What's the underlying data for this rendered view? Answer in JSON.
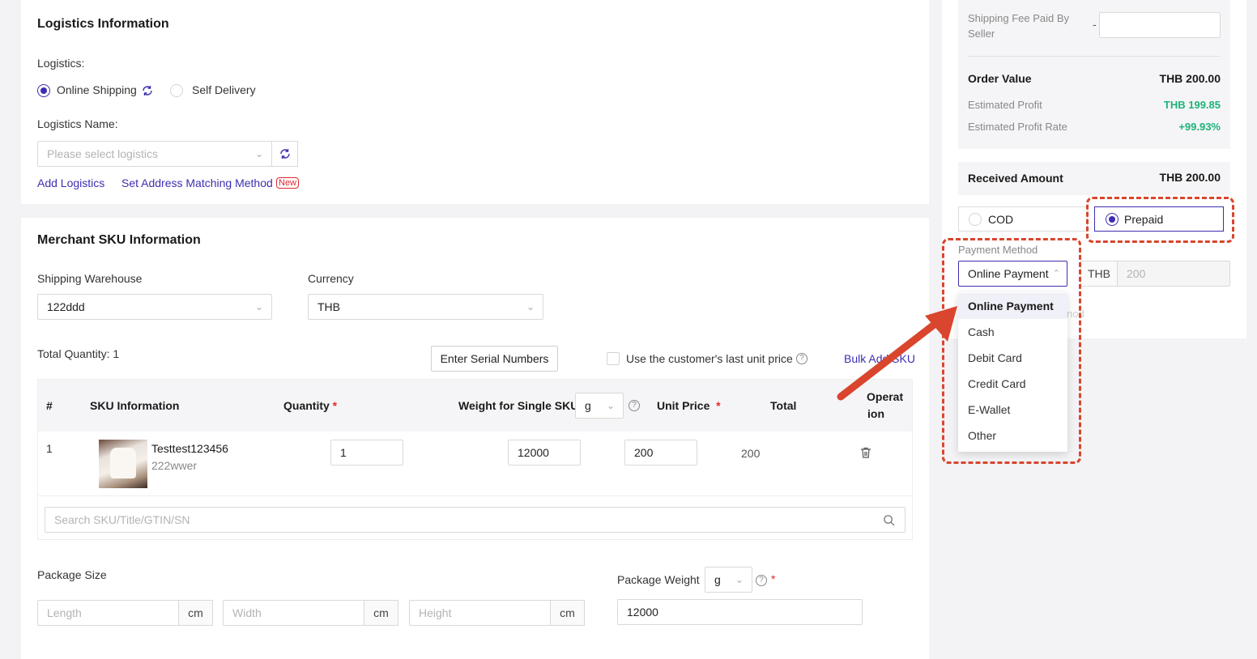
{
  "logistics": {
    "section_title": "Logistics Information",
    "logistics_label": "Logistics:",
    "online_shipping": "Online Shipping",
    "self_delivery": "Self Delivery",
    "name_label": "Logistics Name:",
    "select_placeholder": "Please select logistics",
    "add_logistics": "Add Logistics",
    "set_address_matching": "Set Address Matching Method",
    "new_badge": "New"
  },
  "sku": {
    "section_title": "Merchant SKU Information",
    "warehouse_label": "Shipping Warehouse",
    "warehouse_value": "122ddd",
    "currency_label": "Currency",
    "currency_value": "THB",
    "total_quantity": "Total Quantity: 1",
    "enter_serial": "Enter Serial Numbers",
    "last_price_label": "Use the customer's last unit price",
    "bulk_add": "Bulk Add SKU",
    "table": {
      "col_index": "#",
      "col_sku": "SKU Information",
      "col_quantity": "Quantity",
      "col_weight": "Weight for Single SKU",
      "weight_unit": "g",
      "col_unit_price": "Unit Price",
      "col_total": "Total",
      "col_operation_1": "Operat",
      "col_operation_2": "ion",
      "row": {
        "index": "1",
        "title": "Testtest123456",
        "code": "222wwer",
        "quantity": "1",
        "weight": "12000",
        "unit_price": "200",
        "total": "200"
      }
    },
    "search_placeholder": "Search SKU/Title/GTIN/SN",
    "package_size_label": "Package Size",
    "length_placeholder": "Length",
    "width_placeholder": "Width",
    "height_placeholder": "Height",
    "cm": "cm",
    "package_weight_label": "Package Weight",
    "package_weight_unit": "g",
    "package_weight_value": "12000"
  },
  "summary": {
    "shipping_fee_label_1": "Shipping Fee Paid By",
    "shipping_fee_label_2": "Seller",
    "shipping_fee_dash": "-",
    "order_value_label": "Order Value",
    "order_value": "THB 200.00",
    "est_profit_label": "Estimated Profit",
    "est_profit": "THB 199.85",
    "est_profit_rate_label": "Estimated Profit Rate",
    "est_profit_rate": "+99.93%",
    "received_label": "Received Amount",
    "received_value": "THB 200.00",
    "cod": "COD",
    "prepaid": "Prepaid",
    "payment_method_label": "Payment Method",
    "payment_method_value": "Online Payment",
    "currency_addon": "THB",
    "amount_value": "200",
    "partial_text": "nod"
  },
  "payment_menu": [
    "Online Payment",
    "Cash",
    "Debit Card",
    "Credit Card",
    "E-Wallet",
    "Other"
  ],
  "colors": {
    "accent": "#3d2fb0",
    "profit": "#1db37a",
    "highlight": "#d9452d"
  }
}
